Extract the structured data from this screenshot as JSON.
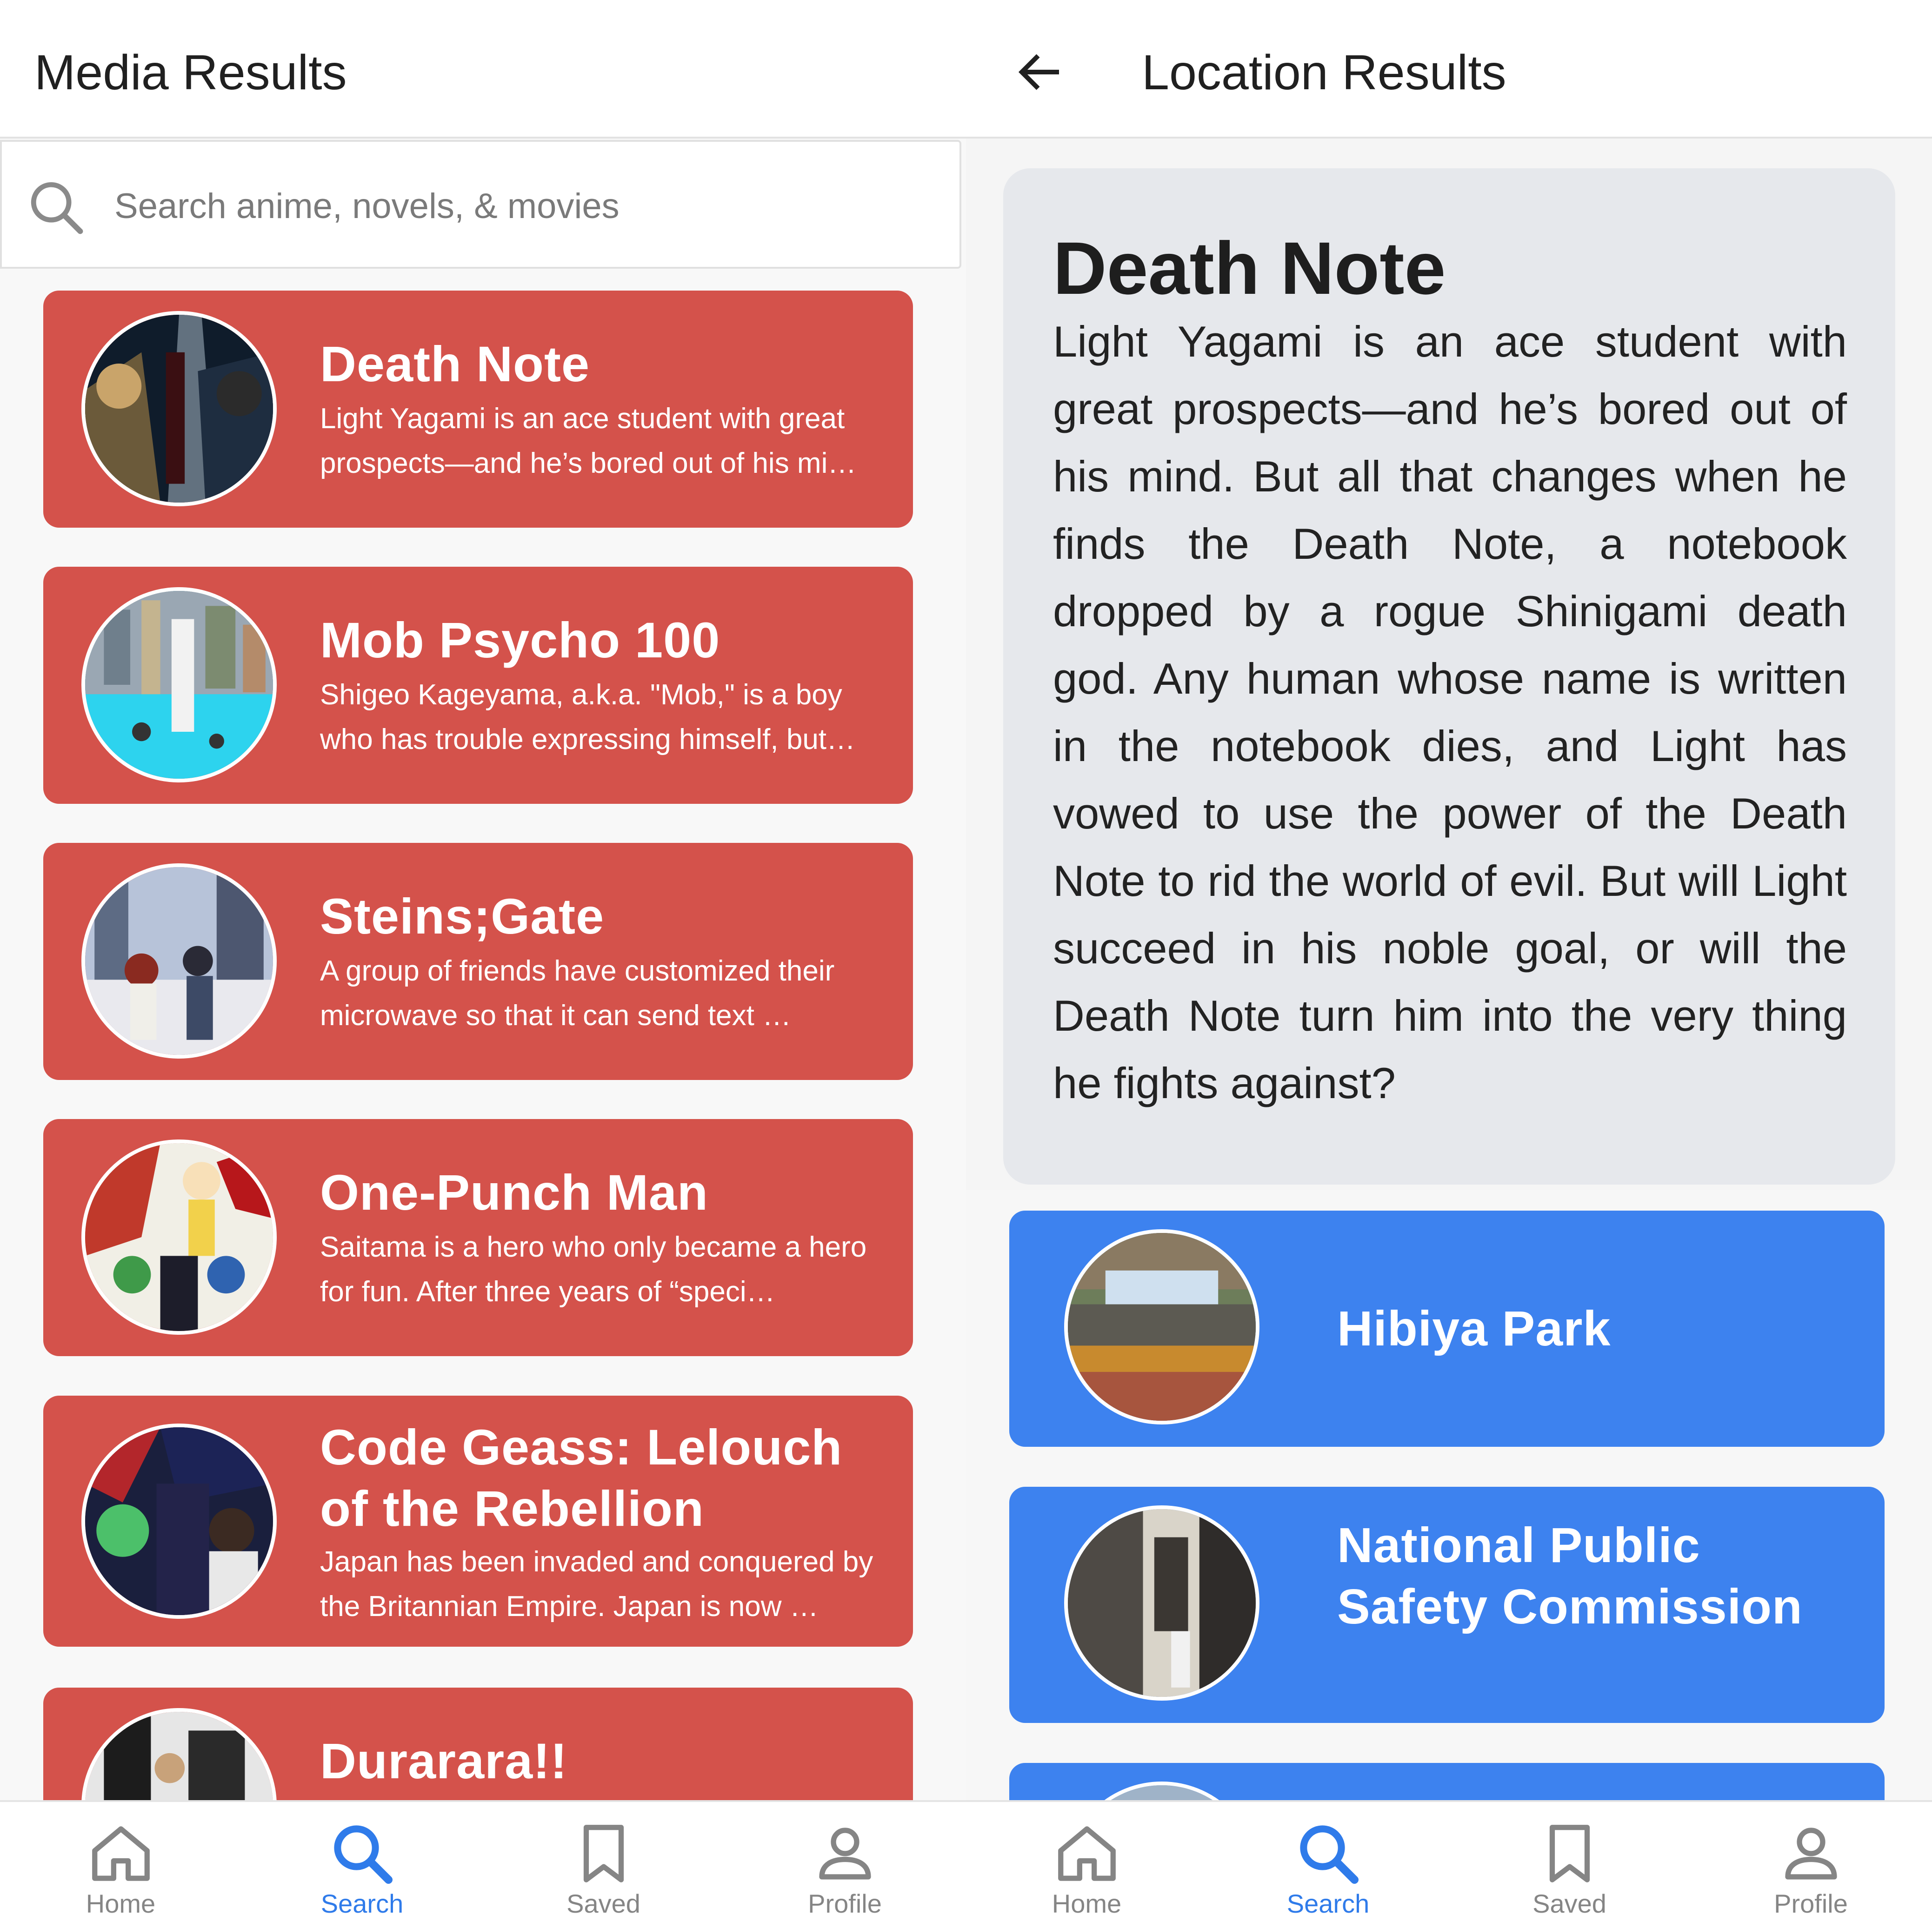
{
  "media_screen": {
    "title": "Media Results",
    "search": {
      "placeholder": "Search anime, novels, & movies",
      "value": ""
    },
    "results": [
      {
        "title": "Death Note",
        "description": "Light Yagami is an ace student with great prospects—and he’s bored out of his mi…"
      },
      {
        "title": "Mob Psycho 100",
        "description": "Shigeo Kageyama, a.k.a. \"Mob,\" is a boy who has trouble expressing himself, but…"
      },
      {
        "title": "Steins;Gate",
        "description": "A group of friends have customized their microwave so that it can send text …"
      },
      {
        "title": "One-Punch Man",
        "description": "Saitama is a hero who only became a hero for fun. After three years of “speci…"
      },
      {
        "title": "Code Geass: Lelouch of the Rebellion",
        "description": "Japan has been invaded and conquered by the Britannian Empire. Japan is now …"
      },
      {
        "title": "Durarara!!",
        "description": ""
      }
    ]
  },
  "location_screen": {
    "title": "Location Results",
    "back_icon": "arrow-left-icon",
    "media": {
      "title": "Death Note",
      "description": "Light Yagami is an ace student with great prospects—and he’s bored out of his mind. But all that changes when he finds the Death Note, a notebook dropped by a rogue Shinigami death god. Any human whose name is written in the notebook dies, and Light has vowed to use the power of the Death Note to rid the world of evil. But will Light succeed in his noble goal, or will the Death Note turn him into the very thing he fights against?"
    },
    "locations": [
      {
        "name": "Hibiya Park"
      },
      {
        "name": "National Public Safety Commission"
      }
    ]
  },
  "bottom_nav": {
    "items": [
      {
        "label": "Home",
        "icon": "home-icon"
      },
      {
        "label": "Search",
        "icon": "search-icon"
      },
      {
        "label": "Saved",
        "icon": "bookmark-icon"
      },
      {
        "label": "Profile",
        "icon": "profile-icon"
      }
    ],
    "active": "Search"
  },
  "colors": {
    "media_card": "#d4524b",
    "location_card": "#3d82ef",
    "nav_active": "#2f7bea",
    "nav_inactive": "#858585",
    "detail_card": "#e6e8ec"
  }
}
